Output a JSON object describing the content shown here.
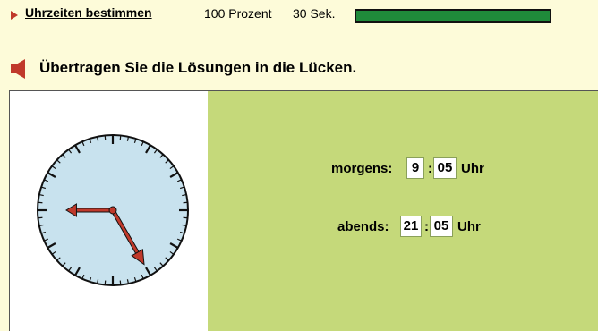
{
  "header": {
    "title_link": "Uhrzeiten bestimmen",
    "percent": "100 Prozent",
    "time_remaining": "30 Sek.",
    "progress_fraction": 1.0
  },
  "instruction": "Übertragen Sie die Lösungen in die Lücken.",
  "clock": {
    "face_color": "#c8e2ee",
    "hand_color": "#c0392b",
    "hour_hand_points_to": 9,
    "minute_hand_points_to": 5
  },
  "answers": {
    "morning": {
      "label": "morgens:",
      "hours": "9",
      "minutes": "05",
      "unit": "Uhr"
    },
    "evening": {
      "label": "abends:",
      "hours": "21",
      "minutes": "05",
      "unit": "Uhr"
    }
  },
  "colors": {
    "background": "#fdfbd9",
    "answer_panel": "#c5d97a",
    "progress_fill": "#1f8a3a"
  }
}
